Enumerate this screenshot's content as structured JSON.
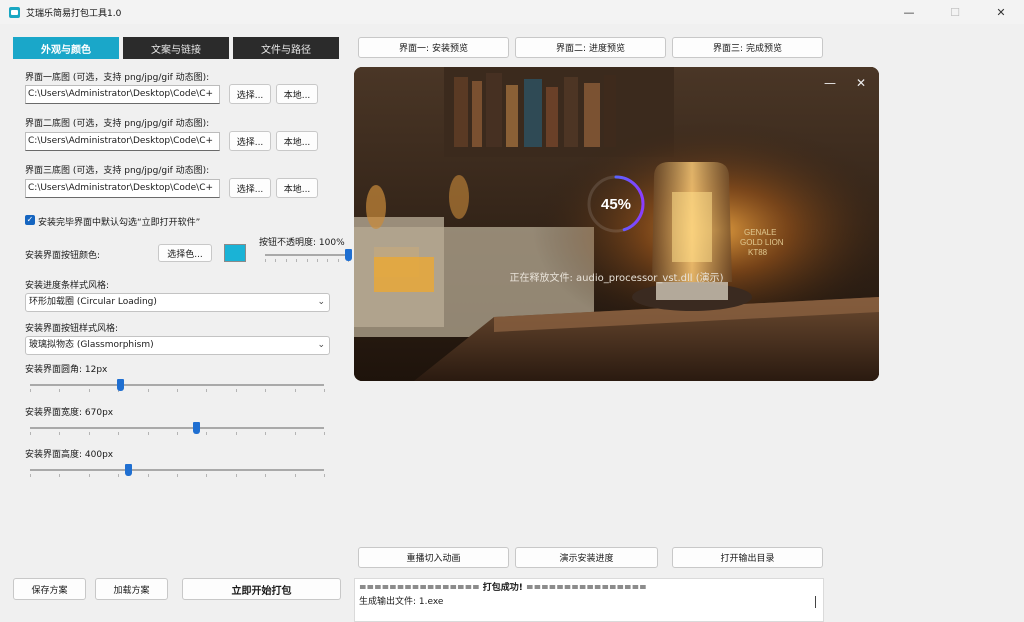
{
  "window": {
    "title": "艾瑞乐简易打包工具1.0",
    "minimize": "—",
    "maximize": "☐",
    "close": "✕"
  },
  "tabs": [
    "外观与颜色",
    "文案与链接",
    "文件与路径"
  ],
  "screens": [
    {
      "label": "界面一底图 (可选，支持 png/jpg/gif 动态图):",
      "path": "C:\\Users\\Administrator\\Desktop\\Code\\C+",
      "choose": "选择...",
      "local": "本地..."
    },
    {
      "label": "界面二底图 (可选，支持 png/jpg/gif 动态图):",
      "path": "C:\\Users\\Administrator\\Desktop\\Code\\C+",
      "choose": "选择...",
      "local": "本地..."
    },
    {
      "label": "界面三底图 (可选，支持 png/jpg/gif 动态图):",
      "path": "C:\\Users\\Administrator\\Desktop\\Code\\C+",
      "choose": "选择...",
      "local": "本地..."
    }
  ],
  "auto_open_checkbox": {
    "label": "安装完毕界面中默认勾选“立即打开软件”",
    "checked": true
  },
  "button_color": {
    "label": "安装界面按钮颜色:",
    "choose": "选择色...",
    "color": "#1ab3d6"
  },
  "opacity": {
    "label": "按钮不透明度: 100%",
    "value": 100
  },
  "progress_style": {
    "label": "安装进度条样式风格:",
    "value": "环形加载圈 (Circular Loading)"
  },
  "button_style": {
    "label": "安装界面按钮样式风格:",
    "value": "玻璃拟物态 (Glassmorphism)"
  },
  "corner_radius": {
    "label": "安装界面圆角: 12px",
    "value": 12
  },
  "width": {
    "label": "安装界面宽度: 670px",
    "value": 670
  },
  "height": {
    "label": "安装界面高度: 400px",
    "value": 400
  },
  "bottom_left": {
    "save": "保存方案",
    "load": "加载方案",
    "start": "立即开始打包"
  },
  "preview_tabs": [
    "界面一: 安装预览",
    "界面二: 进度预览",
    "界面三: 完成预览"
  ],
  "preview": {
    "percent": "45%",
    "progress": 0.45,
    "status": "正在释放文件: audio_processor_vst.dll (演示)",
    "minimize": "—",
    "close": "✕"
  },
  "actions": {
    "replay": "重播切入动画",
    "demo": "演示安装进度",
    "open_output": "打开输出目录"
  },
  "log": {
    "line1": "================ 打包成功! ================",
    "line2": "生成输出文件: 1.exe"
  }
}
